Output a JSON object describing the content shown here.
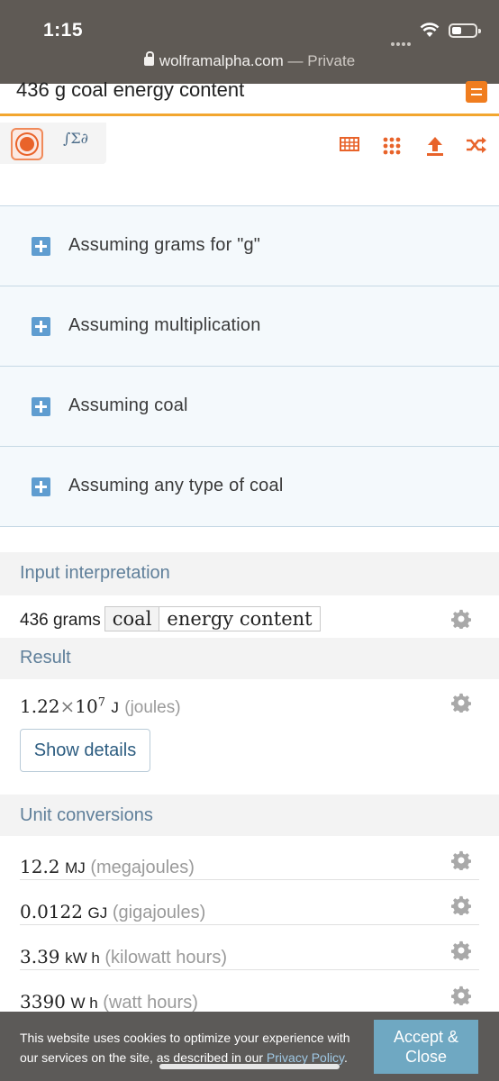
{
  "status": {
    "time": "1:15",
    "url": "wolframalpha.com",
    "private_label": "— Private"
  },
  "search": {
    "query": "436 g coal energy content"
  },
  "assumptions": [
    {
      "label": "Assuming grams for  \"g\""
    },
    {
      "label": "Assuming multiplication"
    },
    {
      "label": "Assuming coal"
    },
    {
      "label": "Assuming any type of coal"
    }
  ],
  "pods": {
    "input": {
      "title": "Input interpretation",
      "quantity": "436 grams",
      "term1": "coal",
      "term2": "energy content"
    },
    "result": {
      "title": "Result",
      "mantissa": "1.22",
      "times": "×",
      "base": "10",
      "exponent": "7",
      "unit": "J",
      "unit_name": "(joules)",
      "details_button": "Show details"
    },
    "conversions": {
      "title": "Unit conversions",
      "rows": [
        {
          "value": "12.2",
          "unit": "MJ",
          "name": "(megajoules)"
        },
        {
          "value": "0.0122",
          "unit": "GJ",
          "name": "(gigajoules)"
        },
        {
          "value": "3.39",
          "unit": "kW h",
          "name": "(kilowatt hours)"
        },
        {
          "value": "3390",
          "unit": "W h",
          "name": "(watt hours)"
        }
      ]
    }
  },
  "cookie": {
    "text": "This website uses cookies to optimize your experience with our services on the site, as described in our",
    "policy_link": "Privacy Policy",
    "period": ".",
    "accept_label_1": "Accept &",
    "accept_label_2": "Close"
  },
  "colors": {
    "accent": "#e8632a",
    "header_bar": "#5f5a55",
    "pod_title": "#5f7f9a",
    "assume_bg": "#f4f9fc"
  }
}
